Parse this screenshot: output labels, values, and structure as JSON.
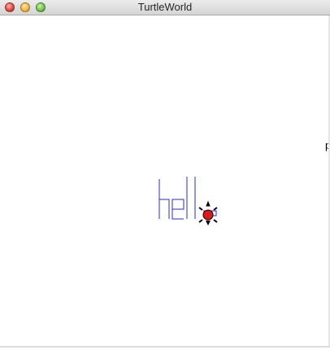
{
  "window": {
    "title": "TurtleWorld"
  },
  "canvas": {
    "edge_fragment_text": "p",
    "drawing": {
      "description_text": "",
      "stroke_color": "#2b2bd1"
    },
    "turtle": {
      "body_color": "#e01818",
      "outline_color": "#000000"
    }
  },
  "icons": {
    "close": "close-icon",
    "minimize": "minimize-icon",
    "zoom": "zoom-icon",
    "turtle": "turtle-icon"
  }
}
